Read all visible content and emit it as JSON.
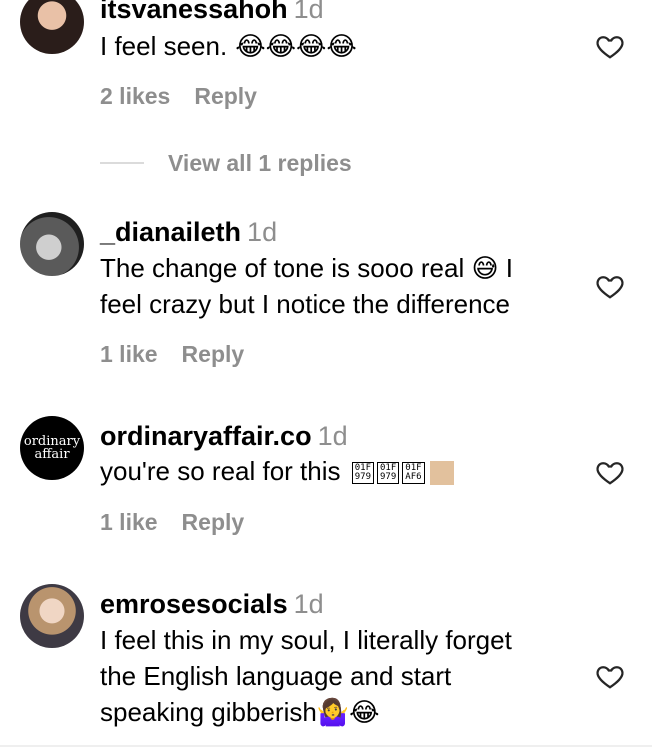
{
  "comments": [
    {
      "author": "itsvanessahoh",
      "time": "1d",
      "text": "I feel seen.",
      "emojis": "😂😂😂😂",
      "likes": "2 likes",
      "reply": "Reply",
      "view_replies": "View all 1 replies"
    },
    {
      "author": "_dianaileth",
      "time": "1d",
      "text_line1": "The change of tone is sooo real 😅 I",
      "text_line2": "feel crazy but I notice the difference",
      "likes": "1 like",
      "reply": "Reply"
    },
    {
      "author": "ordinaryaffair.co",
      "avatar_text_1": "ordinary",
      "avatar_text_2": "affair",
      "time": "1d",
      "text": "you're so real for this",
      "glyph_boxes": [
        {
          "top": "01F",
          "bottom": "979"
        },
        {
          "top": "01F",
          "bottom": "979"
        },
        {
          "top": "01F",
          "bottom": "AF6"
        }
      ],
      "likes": "1 like",
      "reply": "Reply"
    },
    {
      "author": "emrosesocials",
      "time": "1d",
      "text_line1": "I feel this in my soul, I literally forget",
      "text_line2": "the English language and start",
      "text_line3": "speaking gibberish🤷‍♀️😂"
    }
  ],
  "icons": {
    "like": "heart-outline-icon"
  },
  "colors": {
    "secondary_text": "#8e8e8e",
    "divider": "#dbdbdb"
  }
}
